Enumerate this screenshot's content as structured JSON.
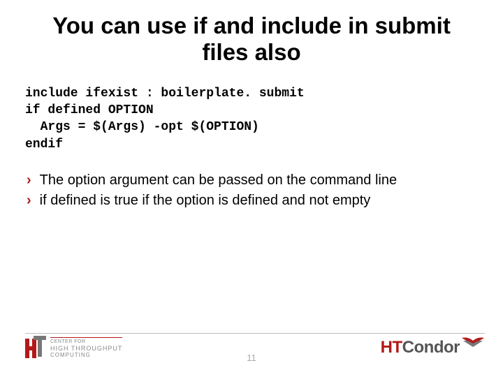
{
  "title": "You can use if and include in submit files also",
  "code": {
    "l1": "include ifexist : boilerplate. submit",
    "l2": "if defined OPTION",
    "l3": "  Args = $(Args) -opt $(OPTION)",
    "l4": "endif"
  },
  "bullets": [
    "The option argument can be passed on the command line",
    "if defined is true if the option is defined and not empty"
  ],
  "footer": {
    "left_logo": {
      "l1": "CENTER FOR",
      "l2": "HIGH THROUGHPUT",
      "l3": "COMPUTING"
    },
    "page_number": "11",
    "right_logo": {
      "part1": "HT",
      "part2": "C",
      "part3": "ondor"
    }
  }
}
